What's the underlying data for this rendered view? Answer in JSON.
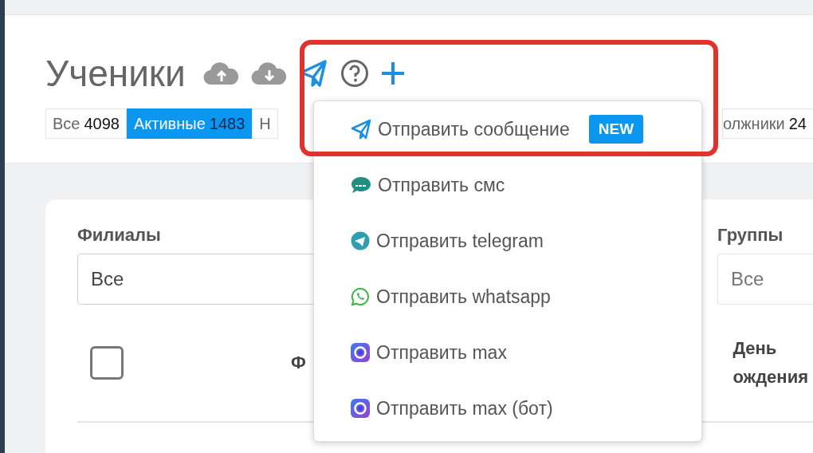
{
  "page_title": "Ученики",
  "header_icons": [
    {
      "kind": "cloud-up"
    },
    {
      "kind": "cloud-down"
    },
    {
      "kind": "plane"
    },
    {
      "kind": "help"
    },
    {
      "kind": "plus"
    }
  ],
  "tabs": [
    {
      "label": "Все",
      "count": "4098",
      "selected": false
    },
    {
      "label": "Активные",
      "count": "1483",
      "selected": true
    },
    {
      "label": "Н",
      "selected": false
    },
    {
      "label": "олжники",
      "count": "24",
      "selected": false
    }
  ],
  "filters": [
    {
      "label": "Филиалы",
      "value": "Все"
    },
    {
      "label": "Группы",
      "placeholder": "Все"
    }
  ],
  "table": {
    "select_all_checked": false,
    "columns": [
      "Ф",
      "День\nождения"
    ]
  },
  "send_menu": [
    {
      "kind": "plane",
      "label": "Отправить сообщение",
      "badge": "NEW"
    },
    {
      "kind": "sms",
      "label": "Отправить смс"
    },
    {
      "kind": "telegram",
      "label": "Отправить telegram"
    },
    {
      "kind": "whatsapp",
      "label": "Отправить whatsapp"
    },
    {
      "kind": "max",
      "label": "Отправить max"
    },
    {
      "kind": "max",
      "label": "Отправить max (бот)"
    }
  ]
}
